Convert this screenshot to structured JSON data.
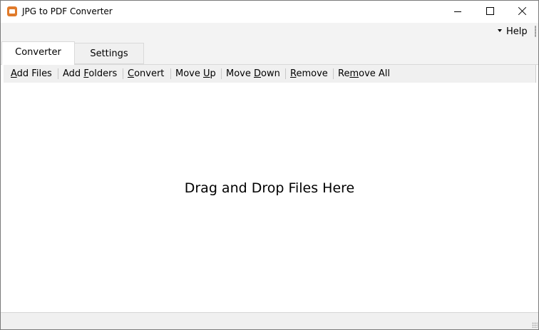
{
  "window": {
    "title": "JPG to PDF Converter"
  },
  "menu": {
    "help": "Help"
  },
  "tabs": [
    {
      "label": "Converter",
      "active": true
    },
    {
      "label": "Settings",
      "active": false
    }
  ],
  "toolbar": {
    "items": [
      {
        "pre": "",
        "key": "A",
        "post": "dd Files"
      },
      {
        "pre": "Add ",
        "key": "F",
        "post": "olders"
      },
      {
        "pre": "",
        "key": "C",
        "post": "onvert"
      },
      {
        "pre": "Move ",
        "key": "U",
        "post": "p"
      },
      {
        "pre": "Move ",
        "key": "D",
        "post": "own"
      },
      {
        "pre": "",
        "key": "R",
        "post": "emove"
      },
      {
        "pre": "Re",
        "key": "m",
        "post": "ove All"
      }
    ]
  },
  "content": {
    "drop_text": "Drag and Drop Files Here"
  },
  "icons": {
    "app": "app-icon",
    "minimize": "minimize-icon",
    "maximize": "maximize-icon",
    "close": "close-icon",
    "help_dropdown": "chevron-down-icon"
  }
}
